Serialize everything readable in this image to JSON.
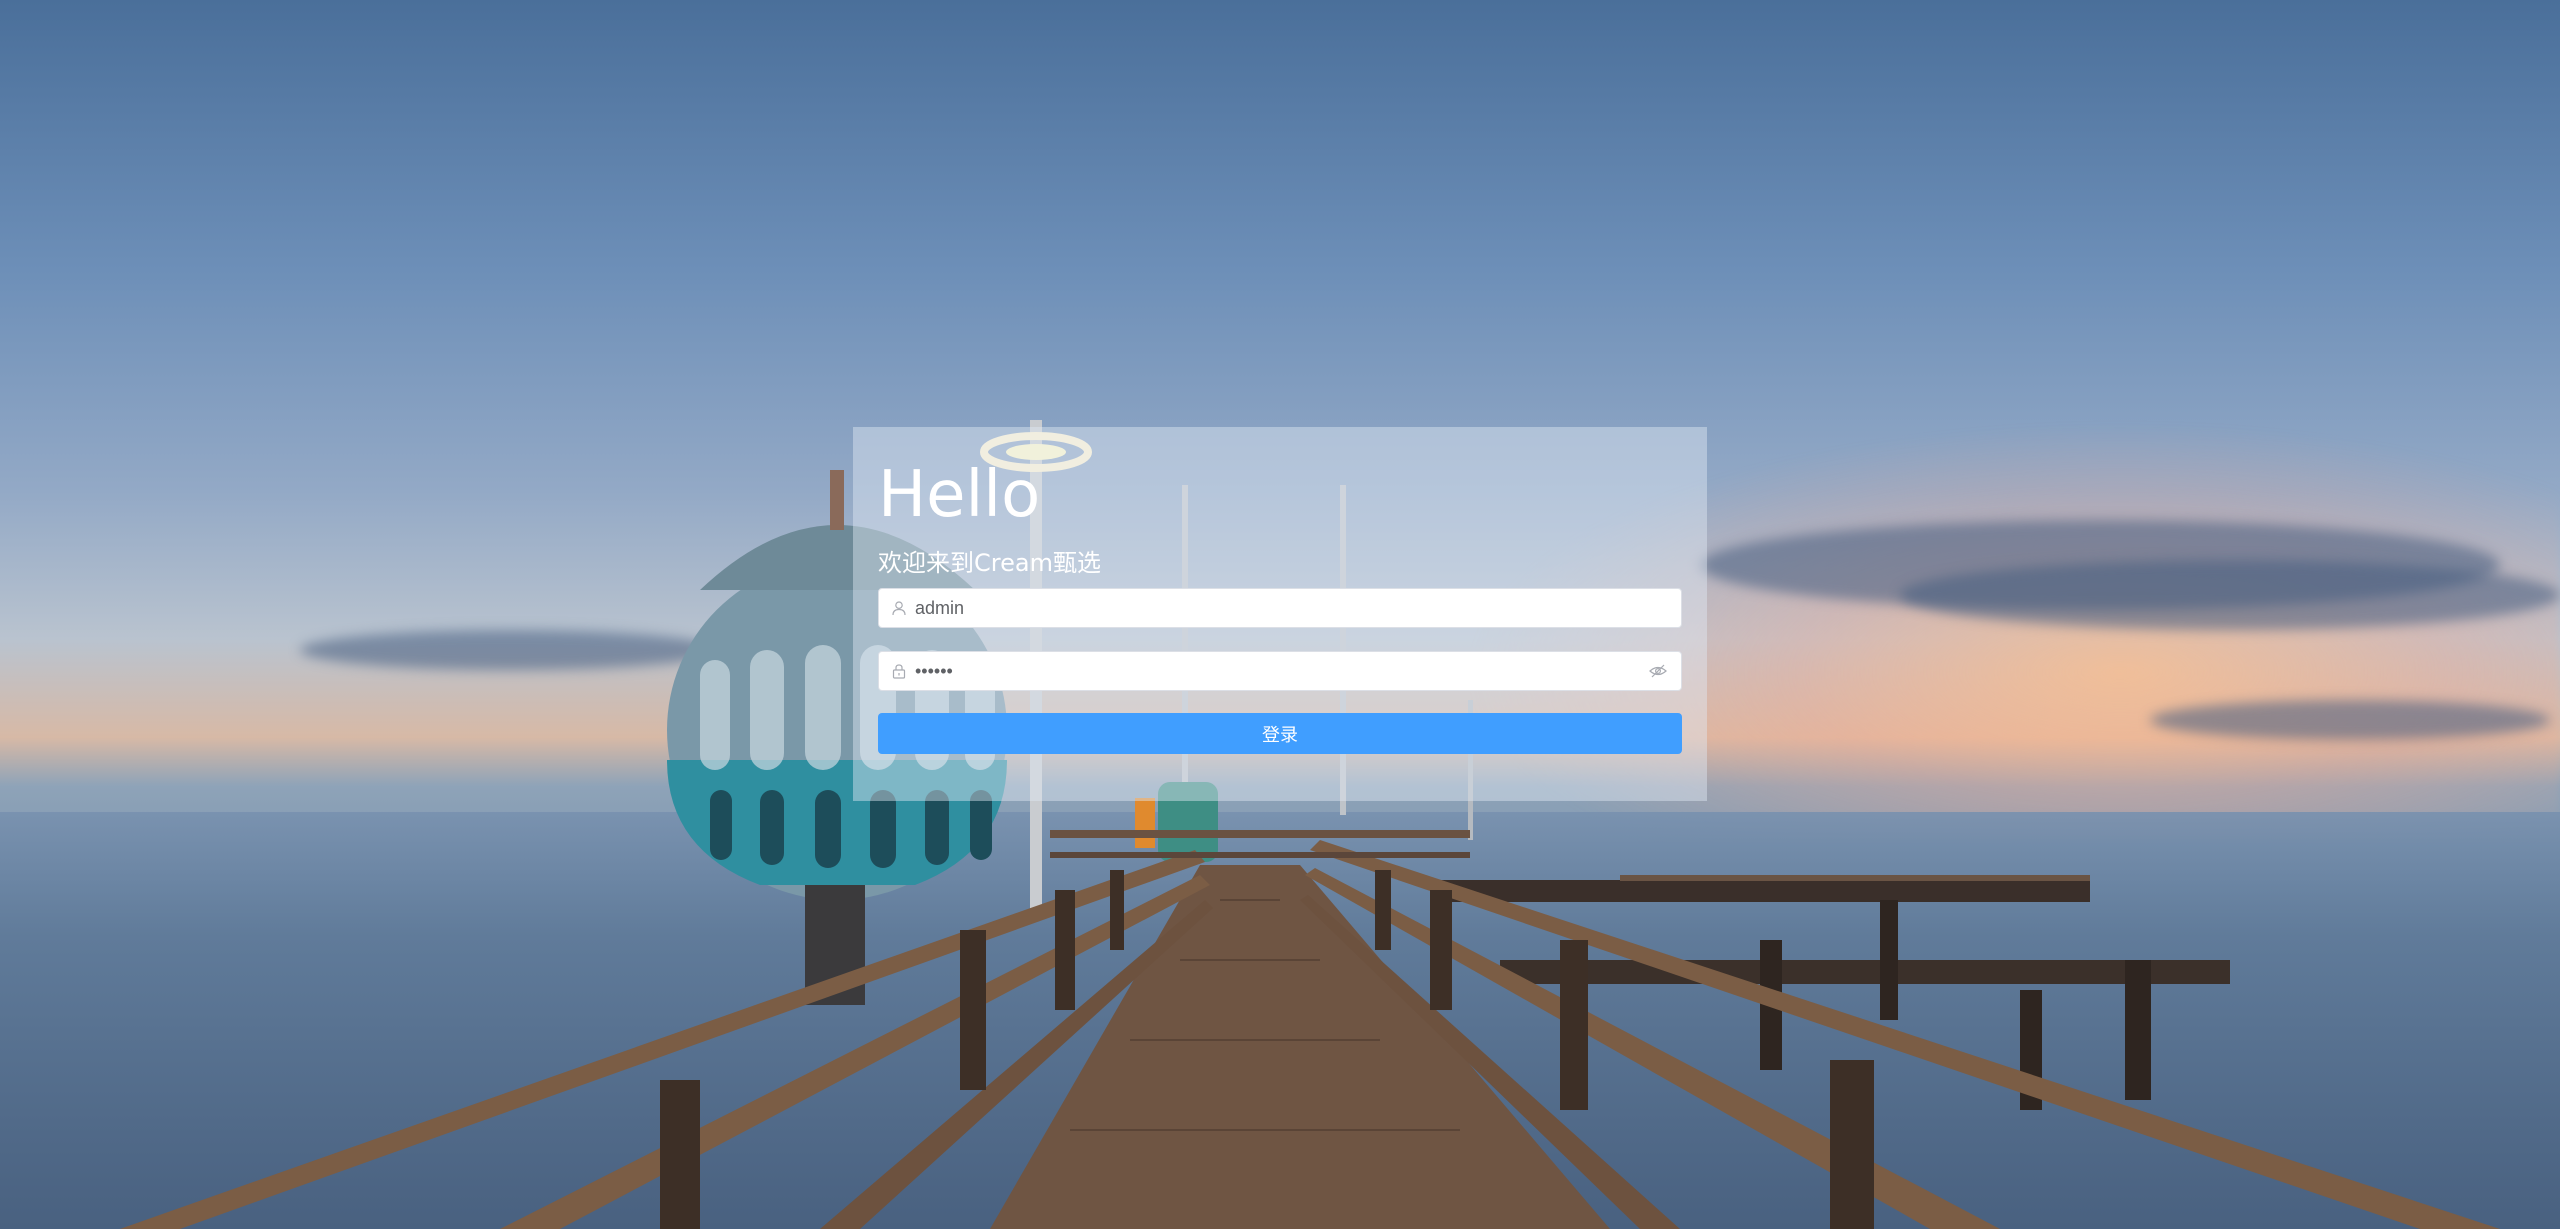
{
  "login": {
    "title": "Hello",
    "subtitle": "欢迎来到Cream甄选",
    "username_value": "admin",
    "password_value": "••••••",
    "submit_label": "登录"
  },
  "icons": {
    "username_prefix": "user-icon",
    "password_prefix": "lock-icon",
    "password_toggle": "eye-hidden-icon"
  },
  "colors": {
    "primary": "#409eff",
    "input_background": "#ffffff",
    "text_white": "#ffffff"
  }
}
